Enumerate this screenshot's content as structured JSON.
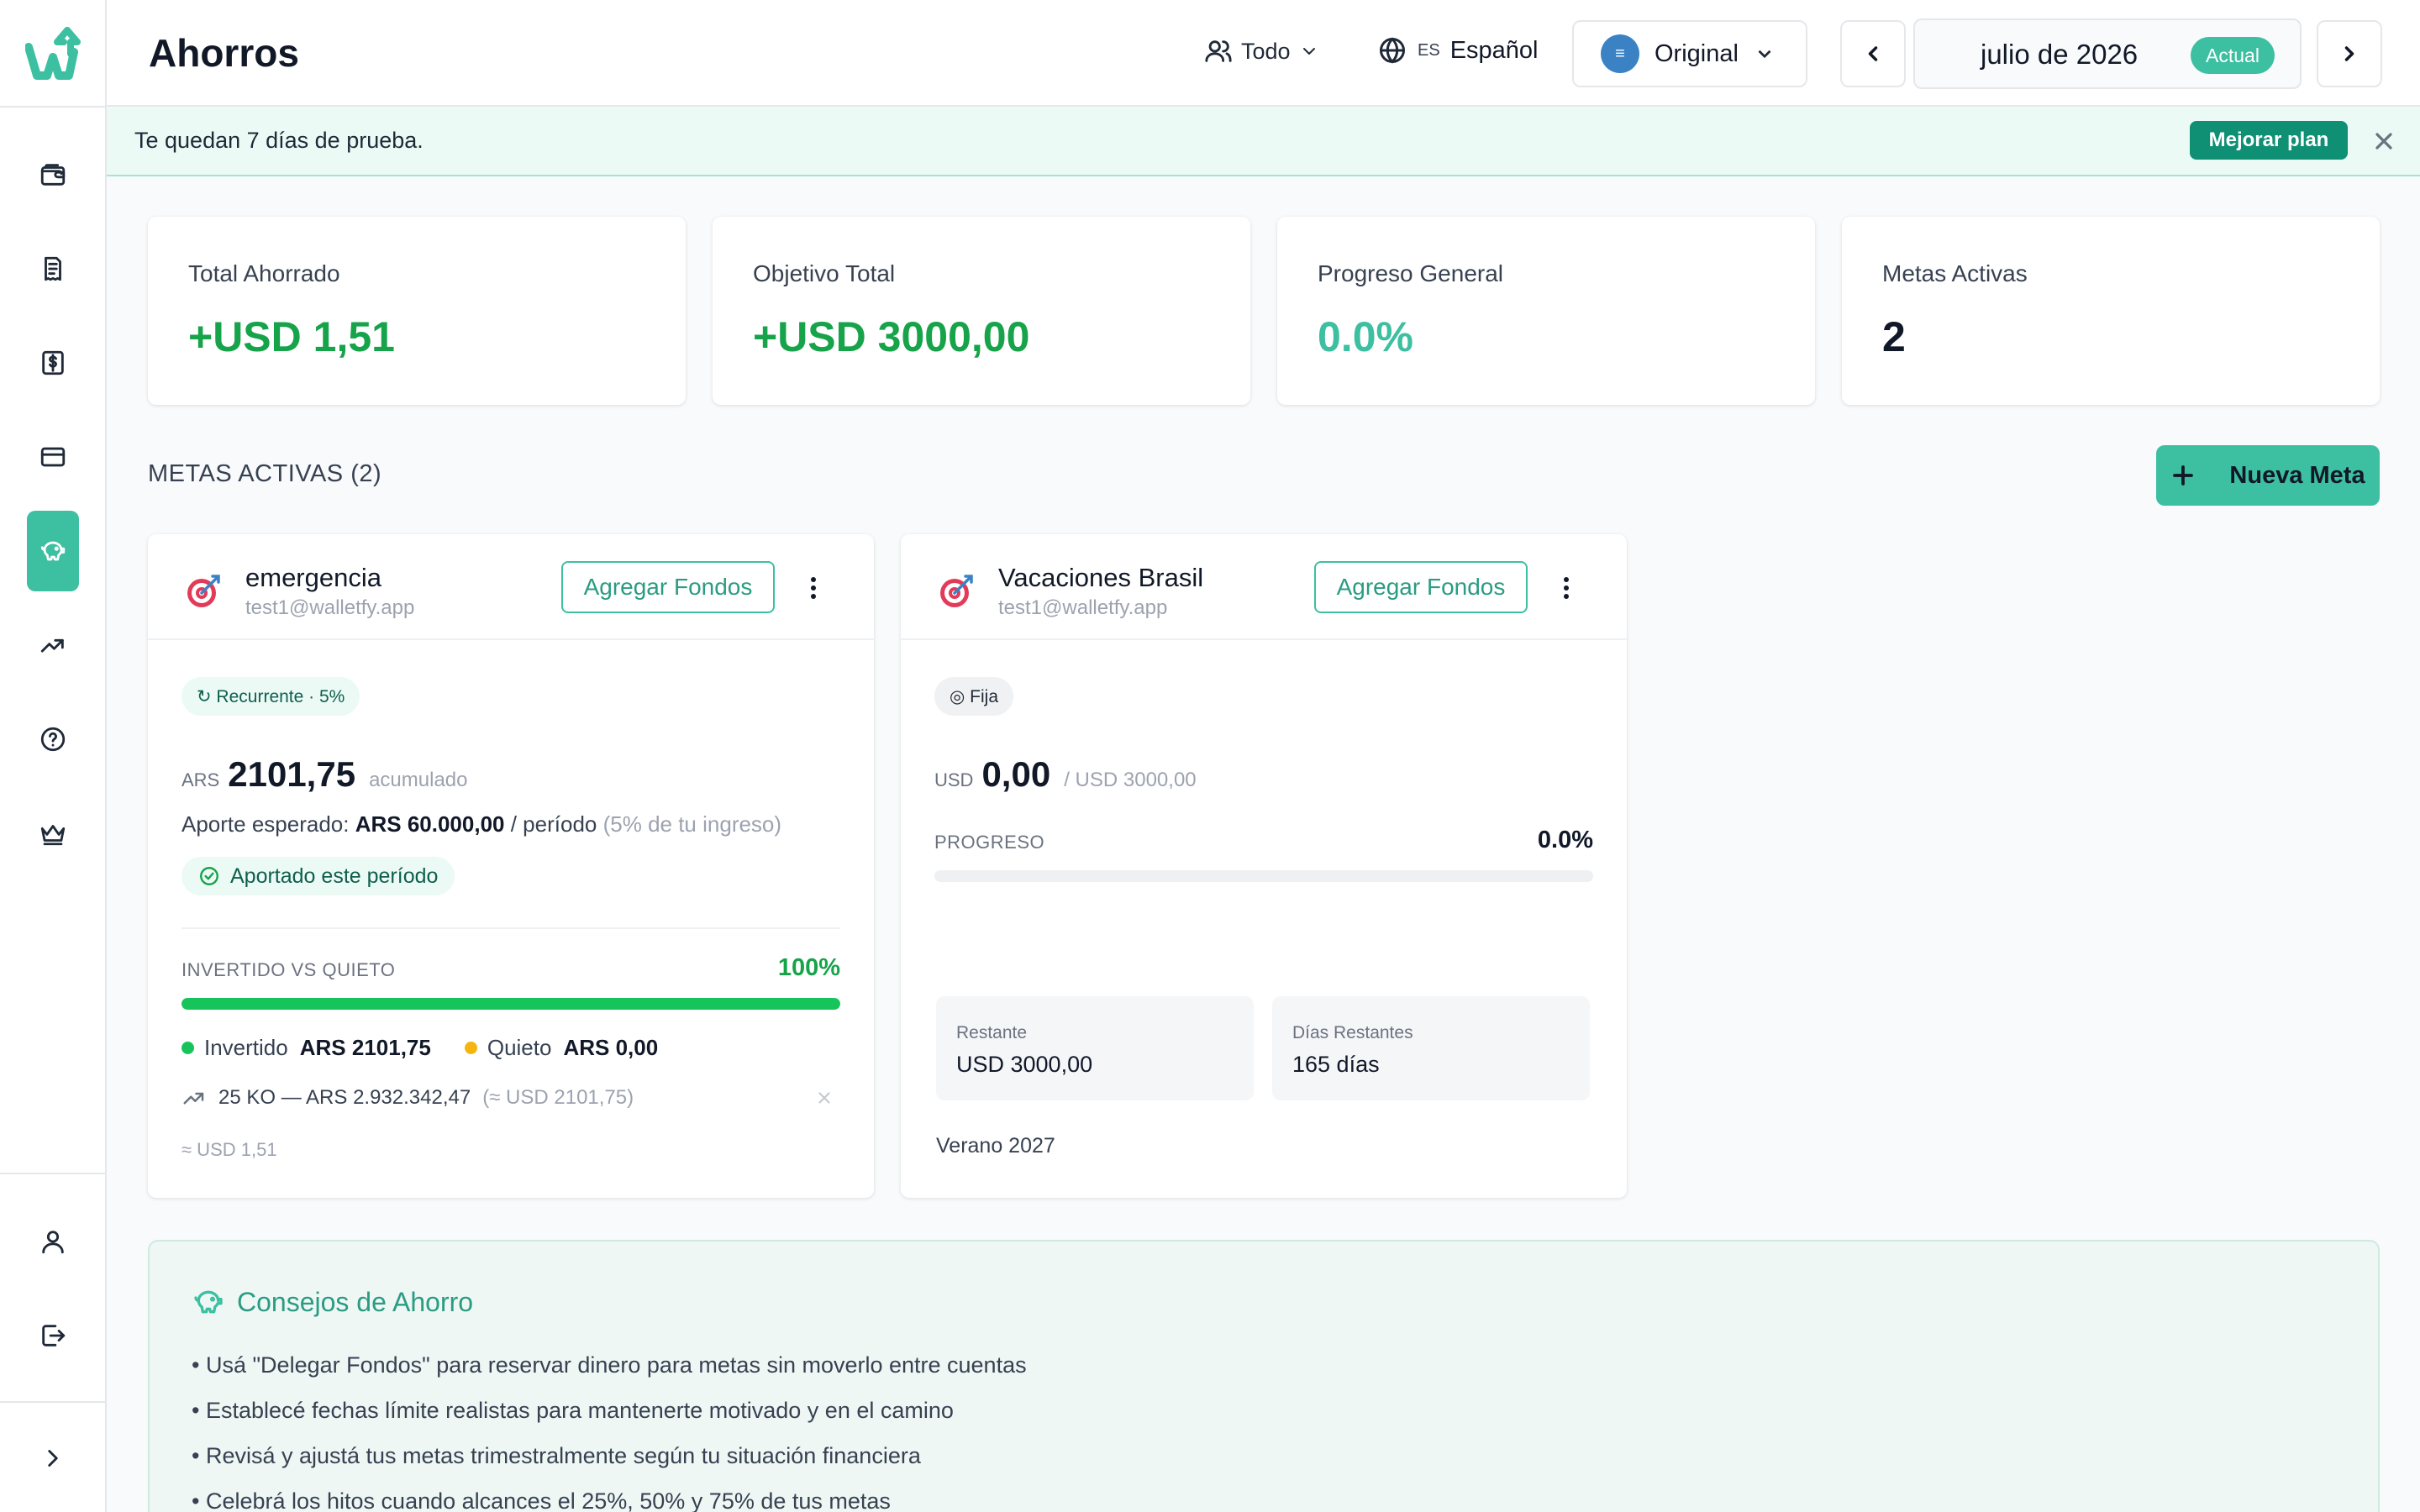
{
  "colors": {
    "accent": "#3dbfa1",
    "accent_dark": "#0f8f74",
    "positive": "#16a34a",
    "invested": "#16c45b",
    "idle": "#f5b50c"
  },
  "header": {
    "title": "Ahorros",
    "filter_label": "Todo",
    "language_code": "ES",
    "language_label": "Español",
    "currency_mode": "Original",
    "currency_icon": "≡",
    "month_label": "julio de 2026",
    "month_badge": "Actual"
  },
  "sidebar": {
    "items": [
      {
        "name": "wallet-icon"
      },
      {
        "name": "receipt-icon"
      },
      {
        "name": "dollar-document-icon"
      },
      {
        "name": "credit-card-icon"
      },
      {
        "name": "piggy-bank-icon",
        "active": true
      },
      {
        "name": "trending-up-icon"
      },
      {
        "name": "help-circle-icon"
      },
      {
        "name": "crown-icon"
      }
    ],
    "bottom": [
      {
        "name": "user-icon"
      },
      {
        "name": "logout-icon"
      },
      {
        "name": "chevron-right-icon"
      }
    ]
  },
  "trial": {
    "text": "Te quedan 7 días de prueba.",
    "button": "Mejorar plan"
  },
  "stats": [
    {
      "label": "Total Ahorrado",
      "value": "+USD 1,51",
      "color": "#16a34a"
    },
    {
      "label": "Objetivo Total",
      "value": "+USD 3000,00",
      "color": "#16a34a"
    },
    {
      "label": "Progreso General",
      "value": "0.0%",
      "color": "#3dbfa1"
    },
    {
      "label": "Metas Activas",
      "value": "2",
      "color": "#111827"
    }
  ],
  "section": {
    "title": "METAS ACTIVAS (2)",
    "new_goal": "Nueva Meta"
  },
  "goals": [
    {
      "name": "emergencia",
      "email": "test1@walletfy.app",
      "add_funds": "Agregar Fondos",
      "badge": "↻ Recurrente · 5%",
      "currency": "ARS",
      "amount": "2101,75",
      "amount_suffix": "acumulado",
      "expected_prefix": "Aporte esperado:",
      "expected_value": "ARS 60.000,00",
      "expected_period": "/ período",
      "expected_note": "(5% de tu ingreso)",
      "contributed": "Aportado este período",
      "progress_label": "INVERTIDO VS QUIETO",
      "progress_pct": "100%",
      "progress_fraction": 1.0,
      "invested_label": "Invertido",
      "invested_value": "ARS 2101,75",
      "idle_label": "Quieto",
      "idle_value": "ARS 0,00",
      "investment": "25 KO — ARS 2.932.342,47",
      "investment_note": "(≈ USD 2101,75)",
      "approx": "≈ USD 1,51"
    },
    {
      "name": "Vacaciones Brasil",
      "email": "test1@walletfy.app",
      "add_funds": "Agregar Fondos",
      "badge": "◎ Fija",
      "currency": "USD",
      "amount": "0,00",
      "amount_suffix": "/ USD 3000,00",
      "progress_label": "PROGRESO",
      "progress_pct": "0.0%",
      "progress_fraction": 0.0,
      "remaining_label": "Restante",
      "remaining_value": "USD 3000,00",
      "days_label": "Días Restantes",
      "days_value": "165 días",
      "note": "Verano 2027"
    }
  ],
  "tips": {
    "title": "Consejos de Ahorro",
    "items": [
      "• Usá \"Delegar Fondos\" para reservar dinero para metas sin moverlo entre cuentas",
      "• Establecé fechas límite realistas para mantenerte motivado y en el camino",
      "• Revisá y ajustá tus metas trimestralmente según tu situación financiera",
      "• Celebrá los hitos cuando alcances el 25%, 50% y 75% de tus metas"
    ]
  }
}
